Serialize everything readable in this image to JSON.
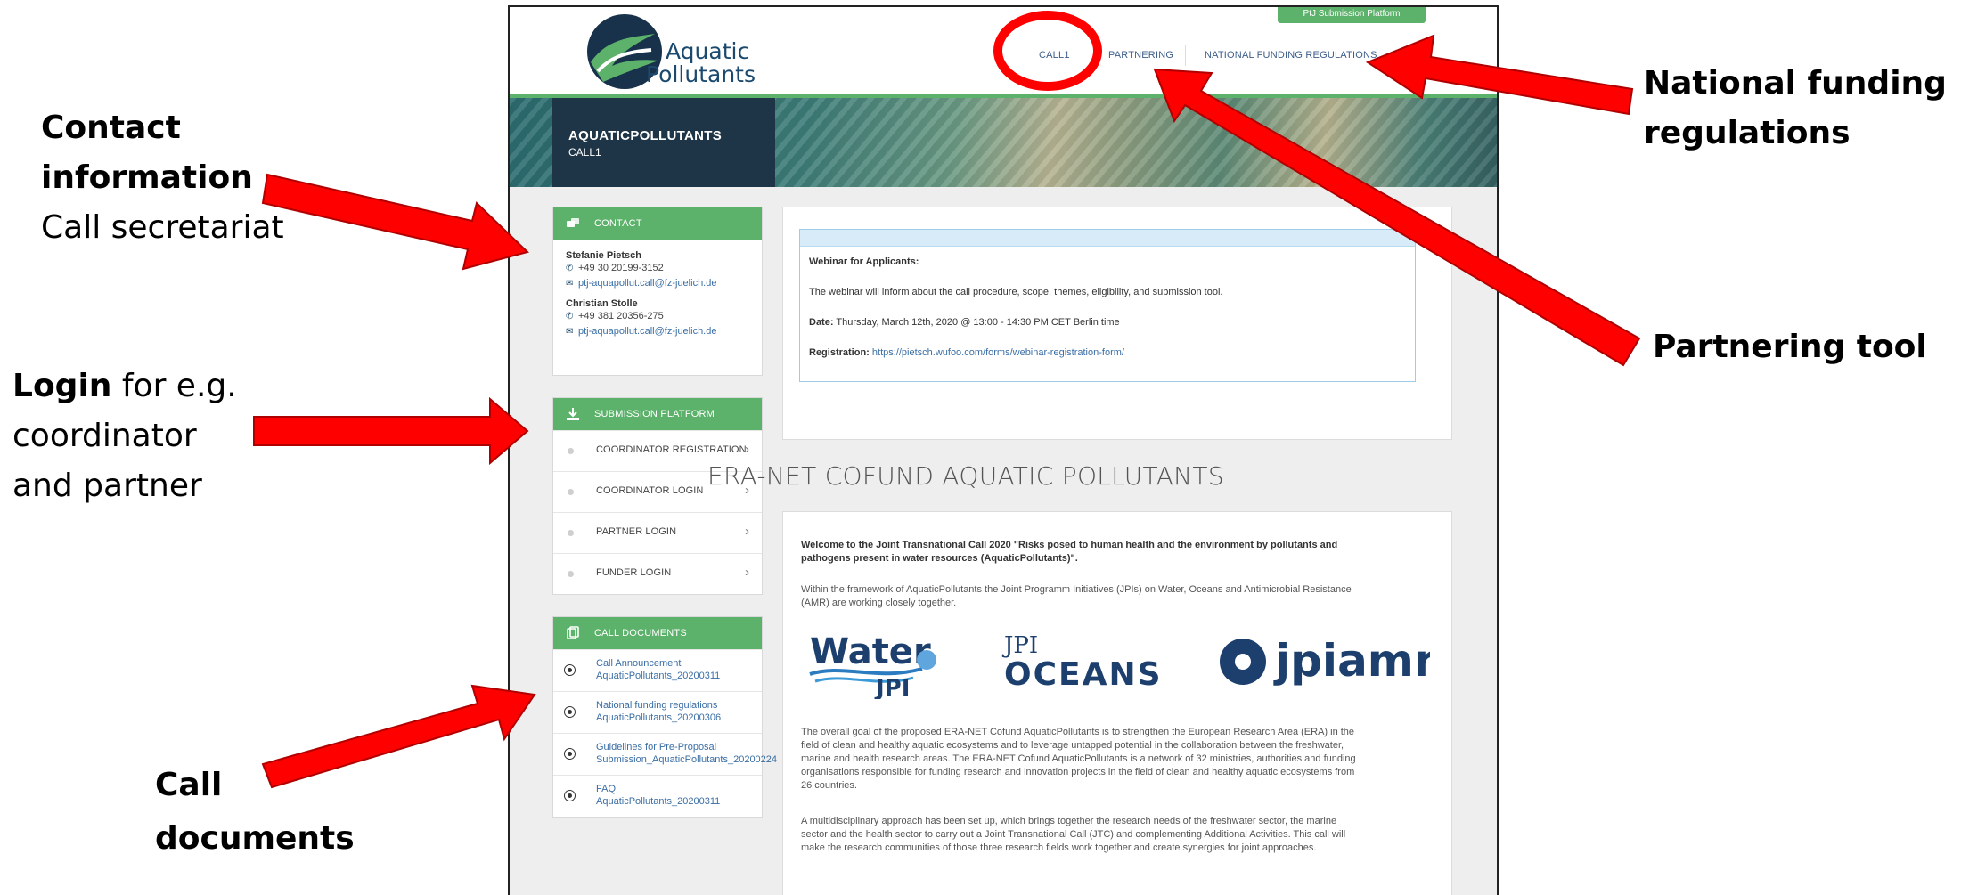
{
  "annotations": {
    "contact": {
      "bold1": "Contact",
      "bold2": "information",
      "normal": "Call secretariat"
    },
    "login": {
      "bold": "Login",
      "rest1": " for e.g.",
      "line2": "coordinator",
      "line3": "and partner"
    },
    "docs": {
      "line1": "Call",
      "line2": "documents"
    },
    "national": {
      "line1": "National funding",
      "line2": "regulations"
    },
    "partnering": {
      "line1": "Partnering tool"
    },
    "arrow_color": "#ff0000"
  },
  "header": {
    "logo_line1": "Aquatic",
    "logo_line2": "Pollutants",
    "nav": [
      "CALL1",
      "PARTNERING",
      "NATIONAL FUNDING REGULATIONS"
    ],
    "submission_button": "PtJ Submission Platform"
  },
  "banner": {
    "title": "AQUATICPOLLUTANTS",
    "subtitle": "CALL1"
  },
  "contact": {
    "heading": "CONTACT",
    "people": [
      {
        "name": "Stefanie Pietsch",
        "phone": "+49 30 20199-3152",
        "email": "ptj-aquapollut.call@fz-juelich.de"
      },
      {
        "name": "Christian Stolle",
        "phone": "+49 381 20356-275",
        "email": "ptj-aquapollut.call@fz-juelich.de"
      }
    ]
  },
  "submission": {
    "heading": "SUBMISSION PLATFORM",
    "items": [
      "COORDINATOR REGISTRATION",
      "COORDINATOR LOGIN",
      "PARTNER LOGIN",
      "FUNDER LOGIN"
    ]
  },
  "documents": {
    "heading": "CALL DOCUMENTS",
    "items": [
      {
        "l1": "Call Announcement",
        "l2": "AquaticPollutants_20200311"
      },
      {
        "l1": "National funding regulations",
        "l2": "AquaticPollutants_20200306"
      },
      {
        "l1": "Guidelines for Pre-Proposal",
        "l2": "Submission_AquaticPollutants_20200224"
      },
      {
        "l1": "FAQ",
        "l2": "AquaticPollutants_20200311"
      }
    ]
  },
  "webinar": {
    "title": "Webinar for Applicants:",
    "text": "The webinar will inform about the call procedure, scope, themes, eligibility, and submission tool.",
    "date_label": "Date:",
    "date": " Thursday, March 12th, 2020 @ 13:00 - 14:30 PM CET Berlin time",
    "reg_label": "Registration:",
    "reg_link": " https://pietsch.wufoo.com/forms/webinar-registration-form/"
  },
  "main": {
    "heading": "ERA-NET COFUND AQUATIC POLLUTANTS",
    "welcome_l1": "Welcome to the Joint Transnational Call 2020 \"Risks posed to human health and the environment by pollutants and",
    "welcome_l2": "pathogens present in water resources (AquaticPollutants)\".",
    "framework_l1": "Within the framework of AquaticPollutants the Joint Programm Initiatives (JPIs) on Water, Oceans and Antimicrobial Resistance",
    "framework_l2": "(AMR) are working closely together.",
    "logos": {
      "water1": "Water",
      "water2": "JPI",
      "oceans1": "JPI",
      "oceans2": "OCEANS",
      "amr": "jpiamr"
    },
    "goal": [
      "The overall goal of the proposed ERA-NET Cofund AquaticPollutants is to strengthen the European Research Area (ERA) in the",
      "field of clean and healthy aquatic ecosystems and to leverage untapped potential in the collaboration between the freshwater,",
      "marine and health research areas. The ERA-NET Cofund AquaticPollutants is a network of 32 ministries, authorities and funding",
      "organisations responsible for funding research and innovation projects in the field of clean and healthy aquatic ecosystems from",
      "26 countries."
    ],
    "multi": [
      "A multidisciplinary approach has been set up, which brings together the research needs of the freshwater sector, the marine",
      "sector and the health sector to carry out a Joint Transnational Call (JTC) and complementing Additional Activities. This call will",
      "make the research communities of those three research fields work together and create synergies for joint approaches."
    ]
  }
}
